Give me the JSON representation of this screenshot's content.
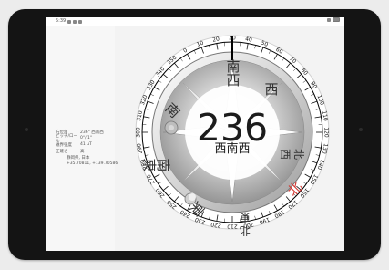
{
  "status_bar": {
    "time": "5:39",
    "signal_icon": "signal-icon",
    "battery_icon": "battery-icon"
  },
  "info_panel": {
    "rows": [
      {
        "label": "方位角",
        "value": "236° 西南西"
      },
      {
        "label": "ピッチ/ロール",
        "value": "0°/ 1°"
      },
      {
        "label": "磁界強度",
        "value": "41 µT"
      },
      {
        "label": "正確さ",
        "value": "高"
      }
    ],
    "location_name": "静岡県, 日本",
    "coordinates": "+35.70811, +139.70586"
  },
  "compass": {
    "heading_degrees": "236",
    "heading_direction": "西南西",
    "directions": [
      "南西",
      "西",
      "北西",
      "北",
      "北東",
      "東",
      "南東",
      "南"
    ],
    "ring_labels": [
      "330",
      "340",
      "350",
      "0",
      "10",
      "20",
      "30",
      "40",
      "50",
      "60",
      "70",
      "80",
      "90",
      "100",
      "110",
      "120",
      "130",
      "140",
      "150",
      "160",
      "170",
      "180",
      "190",
      "200",
      "210",
      "220",
      "230",
      "240",
      "250",
      "260",
      "270",
      "280",
      "290",
      "300",
      "310",
      "320"
    ]
  }
}
